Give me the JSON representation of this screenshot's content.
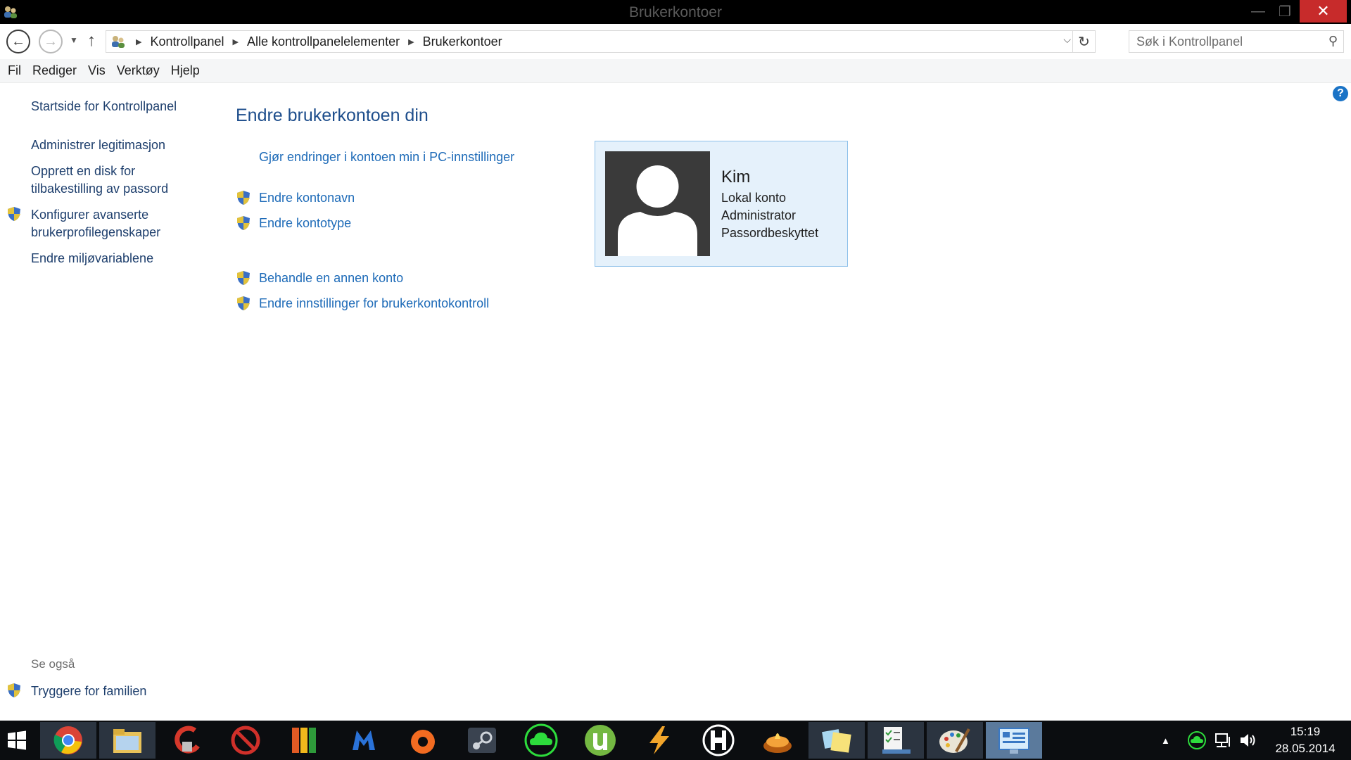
{
  "window": {
    "title": "Brukerkontoer",
    "min_label": "—",
    "max_label": "❐",
    "close_label": "✕"
  },
  "address": {
    "breadcrumbs": [
      "Kontrollpanel",
      "Alle kontrollpanelelementer",
      "Brukerkontoer"
    ],
    "search_placeholder": "Søk i Kontrollpanel"
  },
  "menu": [
    "Fil",
    "Rediger",
    "Vis",
    "Verktøy",
    "Hjelp"
  ],
  "sidebar": {
    "home": "Startside for Kontrollpanel",
    "items": [
      "Administrer legitimasjon",
      "Opprett en disk for",
      "tilbakestilling av passord",
      "Konfigurer avanserte",
      "brukerprofilegenskaper",
      "Endre miljøvariablene"
    ],
    "see_also_title": "Se også",
    "see_also_items": [
      "Tryggere for familien"
    ]
  },
  "main": {
    "title": "Endre brukerkontoen din",
    "tasks": [
      "Gjør endringer i kontoen min i PC-innstillinger",
      "Endre kontonavn",
      "Endre kontotype",
      "Behandle en annen konto",
      "Endre innstillinger for brukerkontokontroll"
    ]
  },
  "account": {
    "name": "Kim",
    "type": "Lokal konto",
    "role": "Administrator",
    "status": "Passordbeskyttet"
  },
  "taskbar": {
    "apps": [
      "chrome-icon",
      "file-explorer-icon",
      "ccleaner-icon",
      "blocked-app-icon",
      "avg-icon",
      "malwarebytes-icon",
      "origin-icon",
      "steam-icon",
      "cloud-sync-icon",
      "utorrent-icon",
      "winamp-icon",
      "ble-icon",
      "burner-icon",
      "sticky-notes-icon",
      "task-manager-icon",
      "paint-icon",
      "control-panel-icon"
    ],
    "time": "15:19",
    "date": "28.05.2014"
  },
  "colors": {
    "accent_link": "#1e6bb8",
    "title_blue": "#1e4e8c",
    "card_bg": "#e5f1fb",
    "close_red": "#c72b2b"
  }
}
